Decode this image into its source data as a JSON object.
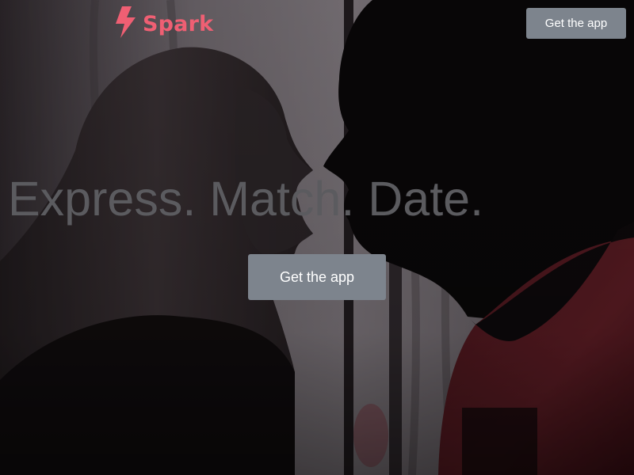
{
  "brand": {
    "name": "Spark",
    "icon": "lightning-bolt-icon",
    "color": "#ef5f73"
  },
  "header": {
    "cta_label": "Get the app"
  },
  "hero": {
    "headline": "Express. Match. Date.",
    "cta_label": "Get the app",
    "background_image": "silhouette-couple-photo"
  },
  "colors": {
    "button_bg": "#7d848d",
    "headline_text": "#5b5b5f",
    "button_text": "#ffffff"
  }
}
